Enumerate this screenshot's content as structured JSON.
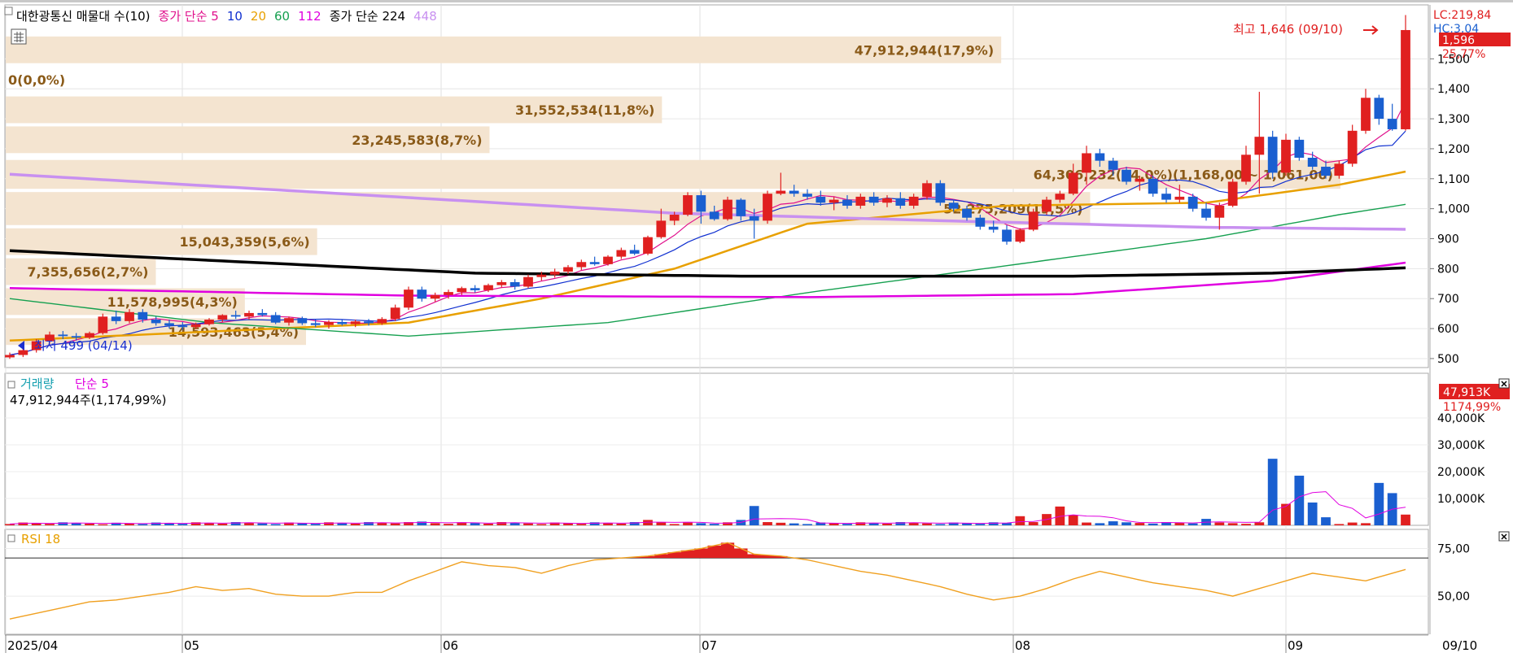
{
  "price_panel": {
    "title_items": [
      {
        "text": "대한광통신 매물대 수(10)",
        "color": "#000000"
      },
      {
        "text": "종가 단순 5",
        "color": "#e0108c"
      },
      {
        "text": "10",
        "color": "#1030d0"
      },
      {
        "text": "20",
        "color": "#e8a000"
      },
      {
        "text": "60",
        "color": "#16a050"
      },
      {
        "text": "112",
        "color": "#e000e0"
      },
      {
        "text": "종가 단순 224",
        "color": "#000000"
      },
      {
        "text": "448",
        "color": "#c890f0"
      }
    ],
    "lc_label": "LC:219,84",
    "hc_label": "HC:3,04",
    "current_price": "1,596",
    "current_pct": "25,77%",
    "high_annotation": "최고 1,646 (09/10)",
    "low_annotation": "최저 499 (04/14)",
    "accent_colors": {
      "up": "#e02020",
      "down": "#1a5fd0",
      "volume_profile": "#f4e4d0",
      "profile_text": "#8a5a18"
    }
  },
  "volume_panel": {
    "title_a": "거래량",
    "title_b": "단순 5",
    "info": "47,912,944주(1,174,99%)",
    "current_label": "47,913K",
    "current_pct": "1174,99%"
  },
  "rsi_panel": {
    "title": "RSI 18"
  },
  "x_labels": [
    "2025/04",
    "05",
    "06",
    "07",
    "08",
    "09"
  ],
  "x_end_label": "09/10",
  "chart_data": [
    {
      "type": "candlestick",
      "title": "대한광통신 매물대 수(10)",
      "ylim": [
        470,
        1680
      ],
      "y_ticks": [
        "500",
        "600",
        "700",
        "800",
        "900",
        "1,000",
        "1,100",
        "1,200",
        "1,300",
        "1,400",
        "1,500"
      ],
      "candles": [
        [
          504,
          520,
          499,
          512
        ],
        [
          512,
          540,
          505,
          528
        ],
        [
          528,
          565,
          520,
          558
        ],
        [
          558,
          590,
          550,
          580
        ],
        [
          580,
          592,
          565,
          575
        ],
        [
          575,
          585,
          560,
          570
        ],
        [
          570,
          590,
          565,
          585
        ],
        [
          585,
          650,
          580,
          640
        ],
        [
          640,
          660,
          615,
          625
        ],
        [
          625,
          665,
          618,
          655
        ],
        [
          655,
          665,
          620,
          630
        ],
        [
          630,
          640,
          610,
          618
        ],
        [
          618,
          630,
          600,
          610
        ],
        [
          610,
          622,
          595,
          605
        ],
        [
          605,
          620,
          598,
          615
        ],
        [
          615,
          635,
          610,
          630
        ],
        [
          630,
          648,
          622,
          645
        ],
        [
          645,
          660,
          632,
          640
        ],
        [
          640,
          660,
          630,
          652
        ],
        [
          652,
          665,
          640,
          645
        ],
        [
          645,
          655,
          615,
          620
        ],
        [
          620,
          640,
          610,
          635
        ],
        [
          635,
          640,
          612,
          618
        ],
        [
          618,
          630,
          605,
          612
        ],
        [
          612,
          628,
          600,
          622
        ],
        [
          622,
          630,
          610,
          615
        ],
        [
          615,
          630,
          605,
          624
        ],
        [
          624,
          632,
          610,
          618
        ],
        [
          618,
          638,
          612,
          632
        ],
        [
          632,
          680,
          625,
          670
        ],
        [
          670,
          740,
          662,
          730
        ],
        [
          730,
          740,
          690,
          700
        ],
        [
          700,
          720,
          690,
          712
        ],
        [
          712,
          730,
          700,
          722
        ],
        [
          722,
          740,
          712,
          735
        ],
        [
          735,
          745,
          720,
          728
        ],
        [
          728,
          750,
          722,
          745
        ],
        [
          745,
          762,
          738,
          755
        ],
        [
          755,
          765,
          730,
          740
        ],
        [
          740,
          780,
          735,
          772
        ],
        [
          772,
          790,
          760,
          780
        ],
        [
          780,
          800,
          770,
          790
        ],
        [
          790,
          812,
          782,
          805
        ],
        [
          805,
          830,
          795,
          822
        ],
        [
          822,
          840,
          810,
          815
        ],
        [
          815,
          845,
          810,
          840
        ],
        [
          840,
          870,
          832,
          862
        ],
        [
          862,
          880,
          845,
          850
        ],
        [
          850,
          910,
          845,
          905
        ],
        [
          905,
          1000,
          900,
          960
        ],
        [
          960,
          990,
          945,
          980
        ],
        [
          980,
          1055,
          975,
          1045
        ],
        [
          1045,
          1060,
          950,
          990
        ],
        [
          990,
          1010,
          960,
          965
        ],
        [
          965,
          1040,
          960,
          1030
        ],
        [
          1030,
          1035,
          960,
          975
        ],
        [
          975,
          1000,
          900,
          960
        ],
        [
          960,
          1060,
          950,
          1050
        ],
        [
          1050,
          1120,
          1045,
          1060
        ],
        [
          1060,
          1080,
          1040,
          1050
        ],
        [
          1050,
          1065,
          1030,
          1040
        ],
        [
          1040,
          1060,
          1010,
          1020
        ],
        [
          1020,
          1040,
          995,
          1030
        ],
        [
          1030,
          1045,
          1000,
          1010
        ],
        [
          1010,
          1050,
          1000,
          1040
        ],
        [
          1040,
          1055,
          1010,
          1020
        ],
        [
          1020,
          1045,
          1005,
          1035
        ],
        [
          1035,
          1055,
          1000,
          1010
        ],
        [
          1010,
          1050,
          1000,
          1040
        ],
        [
          1040,
          1095,
          1030,
          1085
        ],
        [
          1085,
          1095,
          1010,
          1020
        ],
        [
          1020,
          1030,
          990,
          1000
        ],
        [
          1000,
          1010,
          960,
          970
        ],
        [
          970,
          980,
          930,
          940
        ],
        [
          940,
          960,
          920,
          930
        ],
        [
          930,
          945,
          880,
          890
        ],
        [
          890,
          935,
          885,
          930
        ],
        [
          930,
          1000,
          925,
          990
        ],
        [
          990,
          1040,
          980,
          1030
        ],
        [
          1030,
          1060,
          1020,
          1050
        ],
        [
          1050,
          1150,
          1045,
          1120
        ],
        [
          1120,
          1210,
          1080,
          1185
        ],
        [
          1185,
          1200,
          1140,
          1160
        ],
        [
          1160,
          1170,
          1110,
          1130
        ],
        [
          1130,
          1140,
          1080,
          1090
        ],
        [
          1090,
          1110,
          1060,
          1100
        ],
        [
          1100,
          1110,
          1040,
          1050
        ],
        [
          1050,
          1070,
          1020,
          1030
        ],
        [
          1030,
          1080,
          1020,
          1040
        ],
        [
          1040,
          1050,
          990,
          1000
        ],
        [
          1000,
          1020,
          960,
          970
        ],
        [
          970,
          1020,
          930,
          1010
        ],
        [
          1010,
          1100,
          1005,
          1090
        ],
        [
          1090,
          1210,
          1080,
          1180
        ],
        [
          1180,
          1390,
          1050,
          1240
        ],
        [
          1240,
          1260,
          1100,
          1120
        ],
        [
          1120,
          1250,
          1110,
          1230
        ],
        [
          1230,
          1240,
          1160,
          1170
        ],
        [
          1170,
          1190,
          1130,
          1140
        ],
        [
          1140,
          1160,
          1100,
          1110
        ],
        [
          1110,
          1160,
          1100,
          1150
        ],
        [
          1150,
          1280,
          1140,
          1260
        ],
        [
          1260,
          1400,
          1250,
          1370
        ],
        [
          1370,
          1380,
          1280,
          1300
        ],
        [
          1300,
          1350,
          1260,
          1265
        ],
        [
          1265,
          1646,
          1260,
          1596
        ]
      ],
      "moving_averages": [
        {
          "name": "5",
          "color": "#e0108c",
          "start": 504,
          "end": 1300
        },
        {
          "name": "10",
          "color": "#1030d0",
          "start": 504,
          "end": 1250
        },
        {
          "name": "20",
          "color": "#e8a000",
          "points": [
            [
              0,
              560
            ],
            [
              30,
              620
            ],
            [
              40,
              700
            ],
            [
              50,
              800
            ],
            [
              60,
              950
            ],
            [
              75,
              1010
            ],
            [
              90,
              1020
            ],
            [
              100,
              1080
            ],
            [
              108,
              1150
            ]
          ]
        },
        {
          "name": "60",
          "color": "#16a050",
          "points": [
            [
              0,
              700
            ],
            [
              15,
              620
            ],
            [
              30,
              575
            ],
            [
              45,
              620
            ],
            [
              60,
              720
            ],
            [
              75,
              810
            ],
            [
              90,
              900
            ],
            [
              100,
              980
            ],
            [
              108,
              1035
            ]
          ]
        },
        {
          "name": "112",
          "color": "#e000e0",
          "points": [
            [
              0,
              735
            ],
            [
              30,
              710
            ],
            [
              60,
              705
            ],
            [
              80,
              715
            ],
            [
              95,
              760
            ],
            [
              108,
              838
            ]
          ]
        },
        {
          "name": "224",
          "color": "#000000",
          "points": [
            [
              0,
              860
            ],
            [
              35,
              785
            ],
            [
              55,
              775
            ],
            [
              80,
              775
            ],
            [
              95,
              785
            ],
            [
              108,
              808
            ]
          ]
        },
        {
          "name": "448",
          "color": "#c890f0",
          "points": [
            [
              0,
              1115
            ],
            [
              50,
              985
            ],
            [
              70,
              960
            ],
            [
              90,
              938
            ],
            [
              108,
              930
            ]
          ]
        }
      ],
      "volume_profile": [
        {
          "label": "47,912,944(17,9%)",
          "low": 1480,
          "high": 1580,
          "pct": 17.9
        },
        {
          "label": "0(0,0%)",
          "low": 1380,
          "high": 1480,
          "pct": 0.0
        },
        {
          "label": "31,552,534(11,8%)",
          "low": 1280,
          "high": 1380,
          "pct": 11.8
        },
        {
          "label": "23,245,583(8,7%)",
          "low": 1180,
          "high": 1280,
          "pct": 8.7
        },
        {
          "label": "64,306,232(24,0%)(1,168,00 ~ 1,061,00)",
          "low": 1061,
          "high": 1168,
          "pct": 24.0
        },
        {
          "label": "52,275,209(19,5%)",
          "low": 940,
          "high": 1061,
          "pct": 19.5
        },
        {
          "label": "15,043,359(5,6%)",
          "low": 840,
          "high": 940,
          "pct": 5.6
        },
        {
          "label": "7,355,656(2,7%)",
          "low": 740,
          "high": 840,
          "pct": 2.7
        },
        {
          "label": "11,578,995(4,3%)",
          "low": 640,
          "high": 740,
          "pct": 4.3
        },
        {
          "label": "14,593,463(5,4%)",
          "low": 540,
          "high": 640,
          "pct": 5.4
        }
      ]
    },
    {
      "type": "bar",
      "title": "거래량 단순 5",
      "ylim": [
        0,
        50000
      ],
      "y_ticks": [
        "10,000K",
        "20,000K",
        "30,000K",
        "40,000K"
      ],
      "spikes": [
        [
          7,
          400
        ],
        [
          30,
          1200
        ],
        [
          31,
          1400
        ],
        [
          48,
          2000
        ],
        [
          49,
          1200
        ],
        [
          55,
          2000
        ],
        [
          56,
          7200
        ],
        [
          76,
          3400
        ],
        [
          78,
          4200
        ],
        [
          79,
          7000
        ],
        [
          80,
          3800
        ],
        [
          83,
          1500
        ],
        [
          90,
          2400
        ],
        [
          95,
          24800
        ],
        [
          96,
          8000
        ],
        [
          97,
          18500
        ],
        [
          98,
          8500
        ],
        [
          99,
          3000
        ],
        [
          103,
          15800
        ],
        [
          104,
          12000
        ],
        [
          105,
          4000
        ],
        [
          106,
          4000
        ],
        [
          107,
          47913
        ]
      ],
      "base": 800
    },
    {
      "type": "line",
      "title": "RSI 18",
      "ylim": [
        30,
        85
      ],
      "y_ticks": [
        "50,00",
        "75,00"
      ],
      "threshold": 70,
      "points": [
        [
          0,
          38
        ],
        [
          2,
          41
        ],
        [
          4,
          44
        ],
        [
          6,
          47
        ],
        [
          8,
          48
        ],
        [
          10,
          50
        ],
        [
          12,
          52
        ],
        [
          14,
          55
        ],
        [
          16,
          53
        ],
        [
          18,
          54
        ],
        [
          20,
          51
        ],
        [
          22,
          50
        ],
        [
          24,
          50
        ],
        [
          26,
          52
        ],
        [
          28,
          52
        ],
        [
          30,
          58
        ],
        [
          32,
          63
        ],
        [
          34,
          68
        ],
        [
          36,
          66
        ],
        [
          38,
          65
        ],
        [
          40,
          62
        ],
        [
          42,
          66
        ],
        [
          44,
          69
        ],
        [
          46,
          70
        ],
        [
          48,
          71
        ],
        [
          50,
          73
        ],
        [
          52,
          75
        ],
        [
          54,
          78
        ],
        [
          56,
          72
        ],
        [
          58,
          71
        ],
        [
          60,
          69
        ],
        [
          62,
          66
        ],
        [
          64,
          63
        ],
        [
          66,
          61
        ],
        [
          68,
          58
        ],
        [
          70,
          55
        ],
        [
          72,
          51
        ],
        [
          74,
          48
        ],
        [
          76,
          50
        ],
        [
          78,
          54
        ],
        [
          80,
          59
        ],
        [
          82,
          63
        ],
        [
          84,
          60
        ],
        [
          86,
          57
        ],
        [
          88,
          55
        ],
        [
          90,
          53
        ],
        [
          92,
          50
        ],
        [
          94,
          54
        ],
        [
          96,
          58
        ],
        [
          98,
          62
        ],
        [
          100,
          60
        ],
        [
          102,
          58
        ],
        [
          104,
          62
        ],
        [
          106,
          66
        ],
        [
          107,
          77
        ]
      ]
    }
  ]
}
